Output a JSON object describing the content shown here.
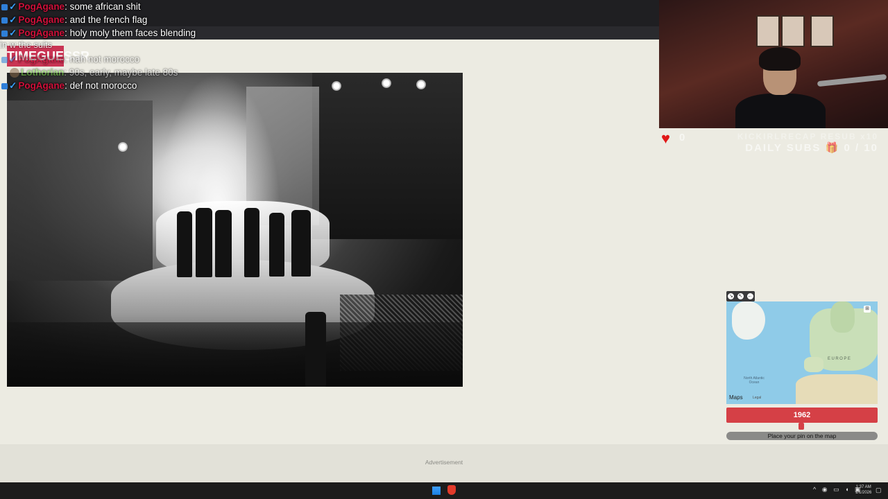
{
  "chat": {
    "messages": [
      {
        "user": "PogAgane",
        "text": ": some african shit",
        "user_color": "#d0103a",
        "faded": false
      },
      {
        "user": "PogAgane",
        "text": ": and the french flag",
        "user_color": "#d0103a",
        "faded": false
      },
      {
        "user": "PogAgane",
        "text": ": holy moly them faces blending",
        "user_color": "#d0103a",
        "faded": false
      },
      {
        "user": "PogAgane",
        "text": ": nah not morocco",
        "user_color": "#d0103a",
        "faded": true
      },
      {
        "user": "Lothorian",
        "text": ": 90s, early, maybe late 80s",
        "user_color": "#7ee04a",
        "faded": true
      },
      {
        "user": "PogAgane",
        "text": ": def not morocco",
        "user_color": "#d0103a",
        "faded": false
      }
    ],
    "overline_text": "in w the suits",
    "logo_text": "TIMEGUESSR"
  },
  "stream": {
    "heart_count": "0",
    "recap_text": "KICKIRLRECAP RESUB x10",
    "daily_subs_label": "DAILY SUBS",
    "daily_subs_value": "0 / 10"
  },
  "map": {
    "region_label": "EUROPE",
    "ocean_label": "North Atlantic Ocean",
    "brand": "Maps",
    "legal": "Legal"
  },
  "game": {
    "year": "1962",
    "place_pin": "Place your pin on the map"
  },
  "ad": {
    "label": "Advertisement"
  },
  "taskbar": {
    "time": "1:37 AM",
    "date": "1/1/2026"
  },
  "colors": {
    "accent": "#d54046",
    "page_bg": "#ecebe2"
  }
}
